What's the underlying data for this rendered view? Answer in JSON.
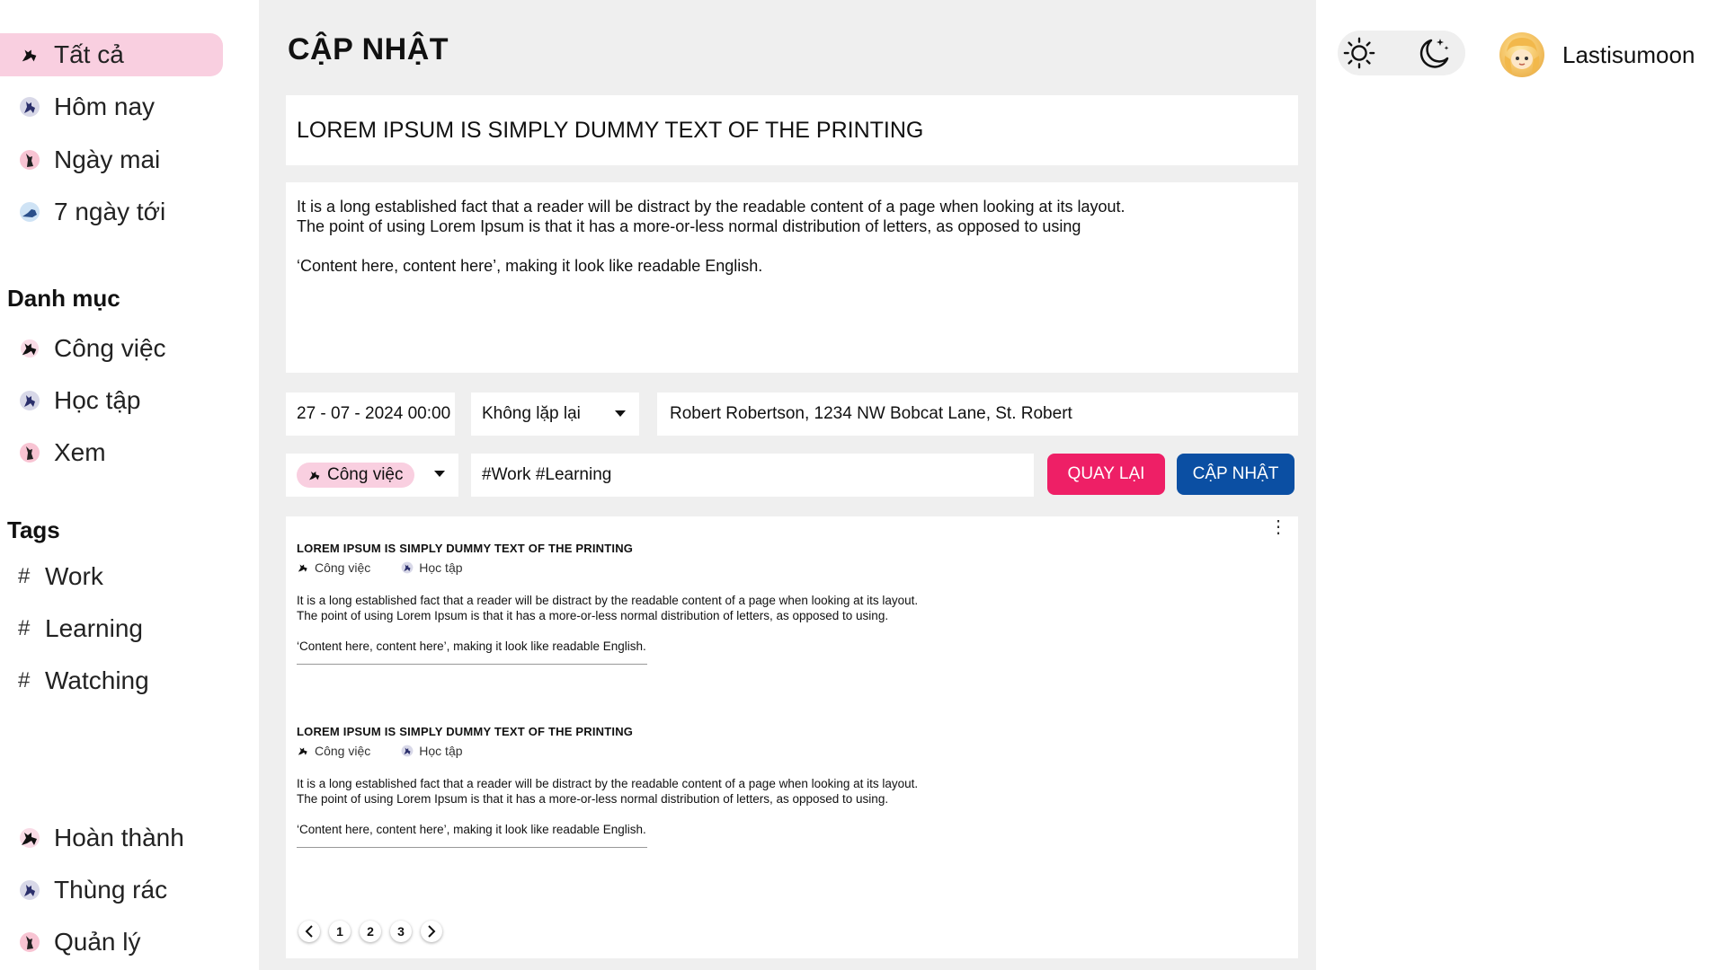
{
  "sidebar": {
    "nav": [
      {
        "label": "Tất cả",
        "icon": "cat-icon",
        "color": "#111111",
        "active": true
      },
      {
        "label": "Hôm nay",
        "icon": "cat-icon",
        "color": "#2b2f6b"
      },
      {
        "label": "Ngày mai",
        "icon": "cat-icon",
        "color": "#d7405e"
      },
      {
        "label": "7 ngày tới",
        "icon": "cat-icon",
        "color": "#3b83c4"
      }
    ],
    "categories_heading": "Danh mục",
    "categories": [
      {
        "label": "Công việc",
        "icon": "cat-icon",
        "color": "#111111"
      },
      {
        "label": "Học tập",
        "icon": "cat-icon",
        "color": "#2b2f6b"
      },
      {
        "label": "Xem",
        "icon": "cat-icon",
        "color": "#d7405e"
      }
    ],
    "tags_heading": "Tags",
    "tags": [
      {
        "hash": "#",
        "label": "Work"
      },
      {
        "hash": "#",
        "label": "Learning"
      },
      {
        "hash": "#",
        "label": "Watching"
      }
    ],
    "bottom": [
      {
        "label": "Hoàn thành",
        "icon": "cat-icon",
        "color": "#111111"
      },
      {
        "label": "Thùng rác",
        "icon": "cat-icon",
        "color": "#2b2f6b"
      },
      {
        "label": "Quản lý",
        "icon": "cat-icon",
        "color": "#d7405e"
      }
    ]
  },
  "main": {
    "title": "CẬP NHẬT",
    "task_title": "LOREM IPSUM IS SIMPLY DUMMY TEXT OF THE PRINTING",
    "body_line1": "It is a long established fact that a reader will be distract by the readable content of a page when looking at its layout.",
    "body_line2": "The point of using Lorem Ipsum is that it has a more-or-less normal distribution of letters, as opposed to using",
    "body_line3": "‘Content here, content here’, making it look like readable English.",
    "date": "27 - 07 - 2024 00:00",
    "repeat": "Không lặp lại",
    "address": "Robert Robertson, 1234 NW Bobcat Lane, St. Robert",
    "category": "Công việc",
    "tags": "#Work #Learning",
    "back_label": "QUAY LẠI",
    "update_label": "CẬP NHẬT",
    "colors": {
      "back": "#ee1f66",
      "update": "#0b4fa3",
      "active": "#f9cfe0"
    }
  },
  "list": {
    "cards": [
      {
        "title": "LOREM IPSUM IS SIMPLY DUMMY TEXT OF THE PRINTING",
        "cat1": "Công việc",
        "cat2": "Học tập",
        "line1": "It is a long established fact that a reader will be distract by the readable content of a page when looking at its layout.",
        "line2": "The point of using Lorem Ipsum is that it has  a more-or-less normal distribution of letters, as opposed to using.",
        "line3": "‘Content here, content here’, making it look like readable English."
      },
      {
        "title": "LOREM IPSUM IS SIMPLY DUMMY TEXT OF THE PRINTING",
        "cat1": "Công việc",
        "cat2": "Học tập",
        "line1": "It is a long established fact that a reader will be distract by the readable content of a page when looking at its layout.",
        "line2": "The point of using Lorem Ipsum is that it has  a more-or-less normal distribution of letters, as opposed to using.",
        "line3": "‘Content here, content here’, making it look like readable English."
      }
    ],
    "pages": [
      "1",
      "2",
      "3"
    ],
    "prev_icon": "chevron-left-icon",
    "next_icon": "chevron-right-icon",
    "more_icon": "kebab-menu-icon"
  },
  "header": {
    "light_icon": "sun-icon",
    "dark_icon": "moon-icon",
    "username": "Lastisumoon"
  }
}
